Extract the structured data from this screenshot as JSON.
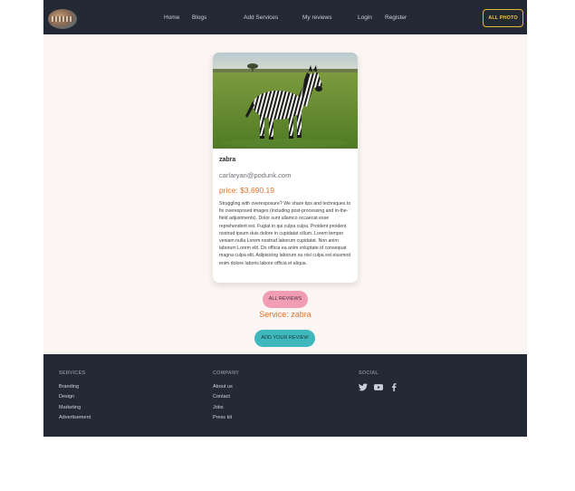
{
  "navbar": {
    "links": [
      "Home",
      "Blogs",
      "Add Services",
      "My reviews",
      "Login",
      "Register"
    ],
    "button": "ALL PHOTO"
  },
  "card": {
    "title": "zabra",
    "email": "carlaryan@podunk.com",
    "price": "price: $3,690.19",
    "description": "Struggling with overexposure? We share tips and techniques to fix overexposed images (including post-processing and in-the-field adjustments). Dolor sunt ullamco occaecat esse reprehenderit est. Fugiat in qui culpa culpa. Proident proident nostrud ipsum duis dolore in cupidatat cillum. Lorem tempor veniam nulla Lorem nostrud laborum cupidatat. Non anim laborum Lorem elit. Do officia ea anim voluptate id consequat magna culpa elit. Adipisicing laborum eu nisi culpa est eiusmod enim dolore laboris labore officia et aliqua."
  },
  "actions": {
    "all_reviews": "ALL REVIEWS",
    "service_line": "Service: zabra",
    "add_review": "ADD YOUR REVIEW"
  },
  "footer": {
    "services": {
      "heading": "SERVICES",
      "items": [
        "Branding",
        "Design",
        "Marketing",
        "Advertisement"
      ]
    },
    "company": {
      "heading": "COMPANY",
      "items": [
        "About us",
        "Contact",
        "Jobs",
        "Press kit"
      ]
    },
    "social": {
      "heading": "SOCIAL",
      "icons": [
        "twitter-icon",
        "youtube-icon",
        "facebook-icon"
      ]
    }
  },
  "colors": {
    "navbar_bg": "#232935",
    "accent_gold": "#e5b53a",
    "price_orange": "#e0702a",
    "pink_button": "#f19db4",
    "teal_button": "#3fb8bd",
    "page_bg": "#fbf6f3"
  }
}
